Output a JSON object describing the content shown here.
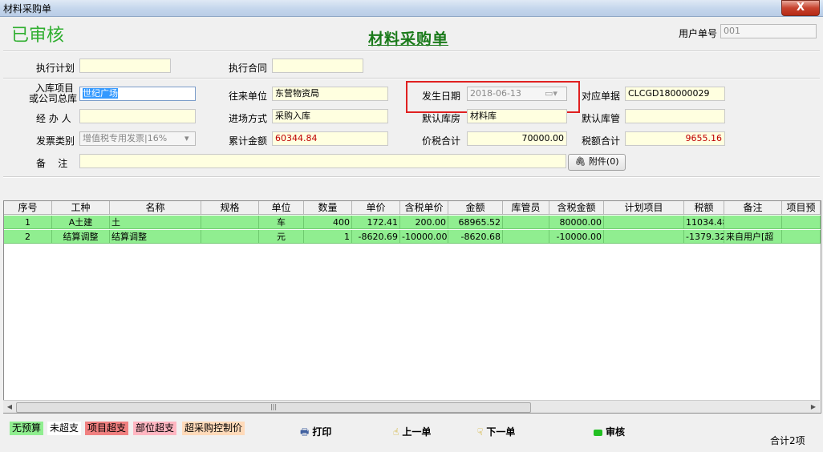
{
  "window": {
    "title": "材料采购单",
    "close_label": "X"
  },
  "header": {
    "status_stamp": "已审核",
    "form_title": "材料采购单",
    "user_no_label": "用户单号",
    "user_no_value": "001"
  },
  "form": {
    "exec_plan_label": "执行计划",
    "exec_plan_value": "",
    "exec_contract_label": "执行合同",
    "exec_contract_value": "",
    "project_label_1": "入库项目",
    "project_label_2": "或公司总库",
    "project_value": "世纪广场",
    "partner_label": "往来单位",
    "partner_value": "东营物资局",
    "date_label": "发生日期",
    "date_value": "2018-06-13",
    "ref_label": "对应单据",
    "ref_value": "CLCGD180000029",
    "handler_label": "经 办 人",
    "handler_value": "",
    "method_label": "进场方式",
    "method_value": "采购入库",
    "warehouse_label": "默认库房",
    "warehouse_value": "材料库",
    "keeper_label": "默认库管",
    "keeper_value": "",
    "invoice_label": "发票类别",
    "invoice_value": "增值税专用发票|16%",
    "total_label": "累计金额",
    "total_value": "60344.84",
    "tax_total_label": "价税合计",
    "tax_total_value": "70000.00",
    "tax_sum_label": "税额合计",
    "tax_sum_value": "9655.16",
    "remark_label": "备    注",
    "remark_value": "",
    "attach_label": "附件(0)"
  },
  "grid": {
    "columns": [
      "序号",
      "工种",
      "名称",
      "规格",
      "单位",
      "数量",
      "单价",
      "含税单价",
      "金额",
      "库管员",
      "含税金额",
      "计划项目",
      "税额",
      "备注",
      "项目预"
    ],
    "rows": [
      [
        "1",
        "A土建",
        "土",
        "",
        "车",
        "400",
        "172.41",
        "200.00",
        "68965.52",
        "",
        "80000.00",
        "",
        "11034.48",
        ""
      ],
      [
        "2",
        "结算调整",
        "结算调整",
        "",
        "元",
        "1",
        "-8620.69",
        "-10000.00",
        "-8620.68",
        "",
        "-10000.00",
        "",
        "-1379.32",
        "来自用户[超"
      ]
    ],
    "row_color": "#90ee90"
  },
  "legend": [
    {
      "label": "无预算",
      "bg": "#90ee90"
    },
    {
      "label": "未超支",
      "bg": "#ffffff"
    },
    {
      "label": "项目超支",
      "bg": "#f08080"
    },
    {
      "label": "部位超支",
      "bg": "#ffb6c1"
    },
    {
      "label": "超采购控制价",
      "bg": "#ffdab9"
    }
  ],
  "actions": {
    "print": "打印",
    "prev": "上一单",
    "next": "下一单",
    "audit": "审核"
  },
  "footer": {
    "count": "合计2项"
  }
}
